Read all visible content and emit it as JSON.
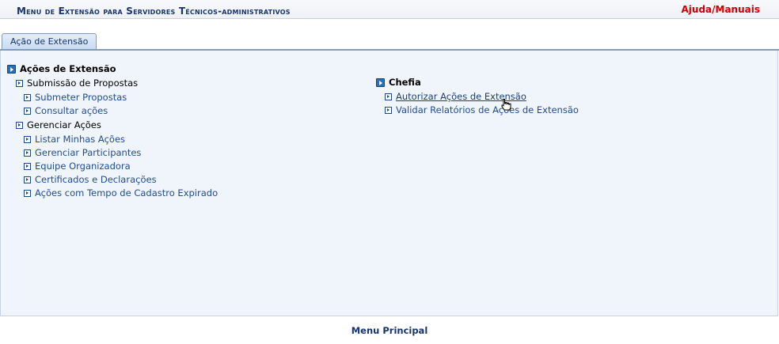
{
  "header": {
    "title": "Menu de Extensão para Servidores Técnicos-administrativos",
    "help_link": "Ajuda/Manuais"
  },
  "tabs": [
    {
      "label": "Ação de Extensão",
      "active": true
    }
  ],
  "left_column": {
    "group_title": "Ações de Extensão",
    "subgroups": [
      {
        "label": "Submissão de Propostas",
        "links": [
          "Submeter Propostas",
          "Consultar ações"
        ]
      },
      {
        "label": "Gerenciar Ações",
        "links": [
          "Listar Minhas Ações",
          "Gerenciar Participantes",
          "Equipe Organizadora",
          "Certificados e Declarações",
          "Ações com Tempo de Cadastro Expirado"
        ]
      }
    ]
  },
  "right_column": {
    "group_title": "Chefia",
    "links": [
      "Autorizar Ações de Extensão",
      "Validar Relatórios de Ações de Extensão"
    ]
  },
  "footer": {
    "main_menu": "Menu Principal"
  },
  "colors": {
    "title": "#17356b",
    "help": "#cc0000",
    "link": "#1f4d8f",
    "panel_bg": "#f0f5fb"
  }
}
